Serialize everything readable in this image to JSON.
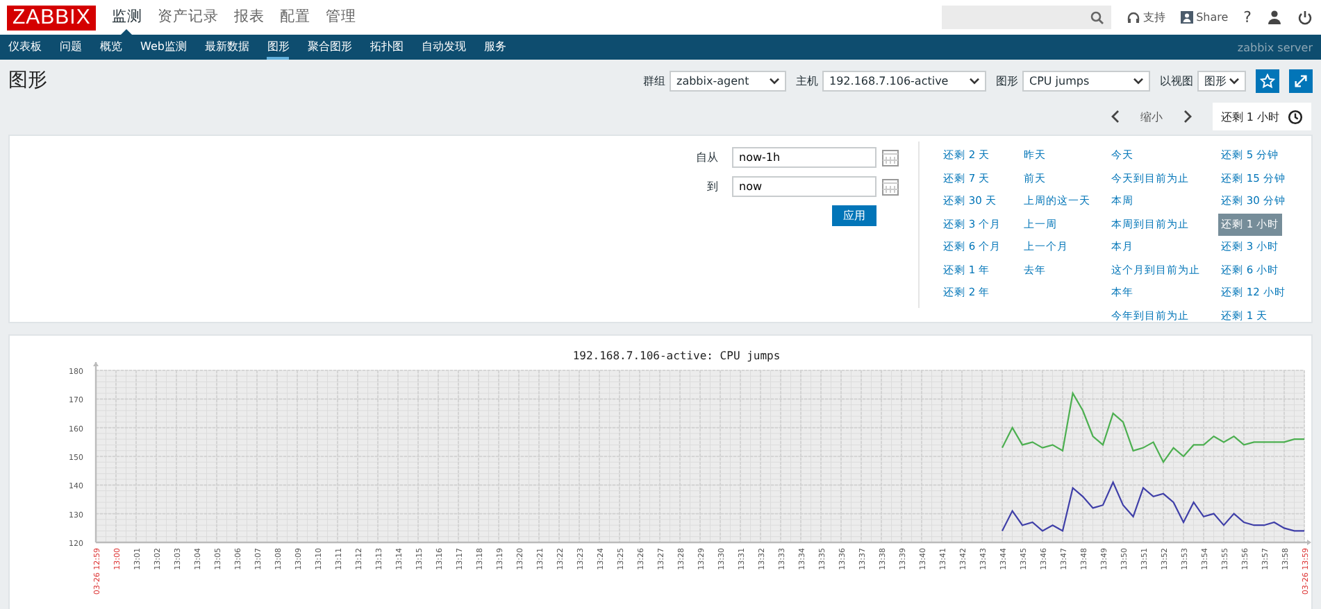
{
  "header": {
    "logo": "ZABBIX",
    "menu": [
      {
        "label": "监测",
        "selected": true
      },
      {
        "label": "资产记录",
        "selected": false
      },
      {
        "label": "报表",
        "selected": false
      },
      {
        "label": "配置",
        "selected": false
      },
      {
        "label": "管理",
        "selected": false
      }
    ],
    "support": "支持",
    "share": "Share",
    "help": "?"
  },
  "subnav": {
    "items": [
      {
        "label": "仪表板",
        "selected": false
      },
      {
        "label": "问题",
        "selected": false
      },
      {
        "label": "概览",
        "selected": false
      },
      {
        "label": "Web监测",
        "selected": false
      },
      {
        "label": "最新数据",
        "selected": false
      },
      {
        "label": "图形",
        "selected": true
      },
      {
        "label": "聚合图形",
        "selected": false
      },
      {
        "label": "拓扑图",
        "selected": false
      },
      {
        "label": "自动发现",
        "selected": false
      },
      {
        "label": "服务",
        "selected": false
      }
    ],
    "server": "zabbix server"
  },
  "page": {
    "title": "图形",
    "filters": [
      {
        "label": "群组",
        "value": "zabbix-agent"
      },
      {
        "label": "主机",
        "value": "192.168.7.106-active"
      },
      {
        "label": "图形",
        "value": "CPU jumps"
      },
      {
        "label": "以视图",
        "value": "图形"
      }
    ]
  },
  "time_nav": {
    "zoom_out": "缩小",
    "current": "还剩 1 小时"
  },
  "time_filter": {
    "from_label": "自从",
    "from": "now-1h",
    "to_label": "到",
    "to": "now",
    "apply": "应用",
    "quick_range_columns": [
      [
        {
          "label": "还剩 2 天",
          "selected": false
        },
        {
          "label": "还剩 7 天",
          "selected": false
        },
        {
          "label": "还剩 30 天",
          "selected": false
        },
        {
          "label": "还剩 3 个月",
          "selected": false
        },
        {
          "label": "还剩 6 个月",
          "selected": false
        },
        {
          "label": "还剩 1 年",
          "selected": false
        },
        {
          "label": "还剩 2 年",
          "selected": false
        }
      ],
      [
        {
          "label": "昨天",
          "selected": false
        },
        {
          "label": "前天",
          "selected": false
        },
        {
          "label": "上周的这一天",
          "selected": false
        },
        {
          "label": "上一周",
          "selected": false
        },
        {
          "label": "上一个月",
          "selected": false
        },
        {
          "label": "去年",
          "selected": false
        }
      ],
      [
        {
          "label": "今天",
          "selected": false
        },
        {
          "label": "今天到目前为止",
          "selected": false
        },
        {
          "label": "本周",
          "selected": false
        },
        {
          "label": "本周到目前为止",
          "selected": false
        },
        {
          "label": "本月",
          "selected": false
        },
        {
          "label": "这个月到目前为止",
          "selected": false
        },
        {
          "label": "本年",
          "selected": false
        },
        {
          "label": "今年到目前为止",
          "selected": false
        }
      ],
      [
        {
          "label": "还剩 5 分钟",
          "selected": false
        },
        {
          "label": "还剩 15 分钟",
          "selected": false
        },
        {
          "label": "还剩 30 分钟",
          "selected": false
        },
        {
          "label": "还剩 1 小时",
          "selected": true
        },
        {
          "label": "还剩 3 小时",
          "selected": false
        },
        {
          "label": "还剩 6 小时",
          "selected": false
        },
        {
          "label": "还剩 12 小时",
          "selected": false
        },
        {
          "label": "还剩 1 天",
          "selected": false
        }
      ]
    ]
  },
  "graph": {
    "chart_data": {
      "type": "line",
      "title": "192.168.7.106-active: CPU jumps",
      "categories": [
        "03-26 12:59",
        null,
        "13:00",
        null,
        "13:01",
        null,
        "13:02",
        null,
        "13:03",
        null,
        "13:04",
        null,
        "13:05",
        null,
        "13:06",
        null,
        "13:07",
        null,
        "13:08",
        null,
        "13:09",
        null,
        "13:10",
        null,
        "13:11",
        null,
        "13:12",
        null,
        "13:13",
        null,
        "13:14",
        null,
        "13:15",
        null,
        "13:16",
        null,
        "13:17",
        null,
        "13:18",
        null,
        "13:19",
        null,
        "13:20",
        null,
        "13:21",
        null,
        "13:22",
        null,
        "13:23",
        null,
        "13:24",
        null,
        "13:25",
        null,
        "13:26",
        null,
        "13:27",
        null,
        "13:28",
        null,
        "13:29",
        null,
        "13:30",
        null,
        "13:31",
        null,
        "13:32",
        null,
        "13:33",
        null,
        "13:34",
        null,
        "13:35",
        null,
        "13:36",
        null,
        "13:37",
        null,
        "13:38",
        null,
        "13:39",
        null,
        "13:40",
        null,
        "13:41",
        null,
        "13:42",
        null,
        "13:43",
        null,
        "13:44",
        null,
        "13:45",
        null,
        "13:46",
        null,
        "13:47",
        null,
        "13:48",
        null,
        "13:49",
        null,
        "13:50",
        null,
        "13:51",
        null,
        "13:52",
        null,
        "13:53",
        null,
        "13:54",
        null,
        "13:55",
        null,
        "13:56",
        null,
        "13:57",
        null,
        "13:58",
        null,
        "03-26 13:59"
      ],
      "series": [
        {
          "color": "#4caf50",
          "values": [
            null,
            null,
            null,
            null,
            null,
            null,
            null,
            null,
            null,
            null,
            null,
            null,
            null,
            null,
            null,
            null,
            null,
            null,
            null,
            null,
            null,
            null,
            null,
            null,
            null,
            null,
            null,
            null,
            null,
            null,
            null,
            null,
            null,
            null,
            null,
            null,
            null,
            null,
            null,
            null,
            null,
            null,
            null,
            null,
            null,
            null,
            null,
            null,
            null,
            null,
            null,
            null,
            null,
            null,
            null,
            null,
            null,
            null,
            null,
            null,
            null,
            null,
            null,
            null,
            null,
            null,
            null,
            null,
            null,
            null,
            null,
            null,
            null,
            null,
            null,
            null,
            null,
            null,
            null,
            null,
            null,
            null,
            null,
            null,
            null,
            null,
            null,
            null,
            null,
            null,
            153,
            160,
            154,
            155,
            153,
            154,
            152,
            172,
            166,
            157,
            154,
            165,
            162,
            152,
            153,
            155,
            148,
            153,
            150,
            154,
            154,
            157,
            155,
            157,
            154,
            155,
            155,
            155,
            155,
            156,
            156
          ]
        },
        {
          "color": "#3f3fa8",
          "values": [
            null,
            null,
            null,
            null,
            null,
            null,
            null,
            null,
            null,
            null,
            null,
            null,
            null,
            null,
            null,
            null,
            null,
            null,
            null,
            null,
            null,
            null,
            null,
            null,
            null,
            null,
            null,
            null,
            null,
            null,
            null,
            null,
            null,
            null,
            null,
            null,
            null,
            null,
            null,
            null,
            null,
            null,
            null,
            null,
            null,
            null,
            null,
            null,
            null,
            null,
            null,
            null,
            null,
            null,
            null,
            null,
            null,
            null,
            null,
            null,
            null,
            null,
            null,
            null,
            null,
            null,
            null,
            null,
            null,
            null,
            null,
            null,
            null,
            null,
            null,
            null,
            null,
            null,
            null,
            null,
            null,
            null,
            null,
            null,
            null,
            null,
            null,
            null,
            null,
            null,
            124,
            131,
            126,
            127,
            124,
            126,
            124,
            139,
            136,
            132,
            133,
            141,
            133,
            129,
            139,
            136,
            137,
            134,
            127,
            134,
            129,
            130,
            126,
            130,
            127,
            126,
            126,
            127,
            125,
            124,
            124
          ]
        }
      ],
      "grid": true,
      "ylim": [
        120,
        180
      ],
      "yticks": [
        120,
        130,
        140,
        150,
        160,
        170,
        180
      ]
    }
  }
}
